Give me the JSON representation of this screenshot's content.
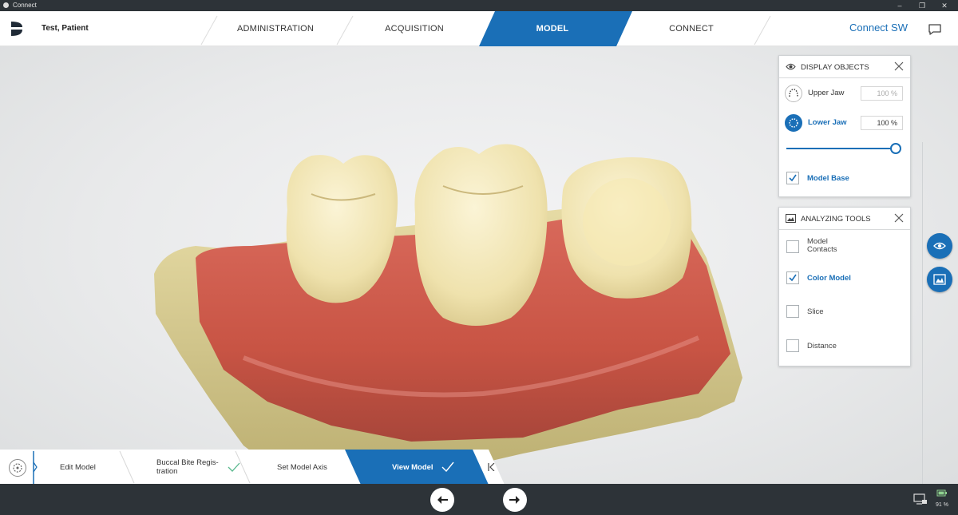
{
  "window": {
    "title": "Connect",
    "controls": [
      "minimize",
      "restore",
      "close"
    ]
  },
  "header": {
    "patient_name": "Test, Patient",
    "tabs": [
      {
        "label": "ADMINISTRATION",
        "active": false
      },
      {
        "label": "ACQUISITION",
        "active": false
      },
      {
        "label": "MODEL",
        "active": true
      },
      {
        "label": "CONNECT",
        "active": false
      }
    ],
    "brand_label": "Connect SW",
    "accent_color": "#1a6fb7"
  },
  "display_objects": {
    "title": "DISPLAY OBJECTS",
    "upper_jaw": {
      "label": "Upper Jaw",
      "opacity": "100 %",
      "selected": false
    },
    "lower_jaw": {
      "label": "Lower Jaw",
      "opacity": "100 %",
      "selected": true
    },
    "opacity_slider_value": 1.0,
    "model_base": {
      "label": "Model Base",
      "checked": true
    }
  },
  "analyzing_tools": {
    "title": "ANALYZING TOOLS",
    "items": [
      {
        "label_line1": "Model",
        "label_line2": "Contacts",
        "checked": false
      },
      {
        "label": "Color Model",
        "checked": true
      },
      {
        "label": "Slice",
        "checked": false
      },
      {
        "label": "Distance",
        "checked": false
      }
    ]
  },
  "workflow": {
    "steps": [
      {
        "label": "Edit Model",
        "done": false,
        "active": false
      },
      {
        "label_line1": "Buccal Bite Regis-",
        "label_line2": "tration",
        "done": true,
        "active": false
      },
      {
        "label": "Set Model Axis",
        "done": false,
        "active": false
      },
      {
        "label": "View Model",
        "done": true,
        "active": true
      }
    ]
  },
  "bottom_bar": {
    "prev_icon": "arrow-left-icon",
    "next_icon": "arrow-right-icon",
    "battery_percent": "91 %"
  }
}
